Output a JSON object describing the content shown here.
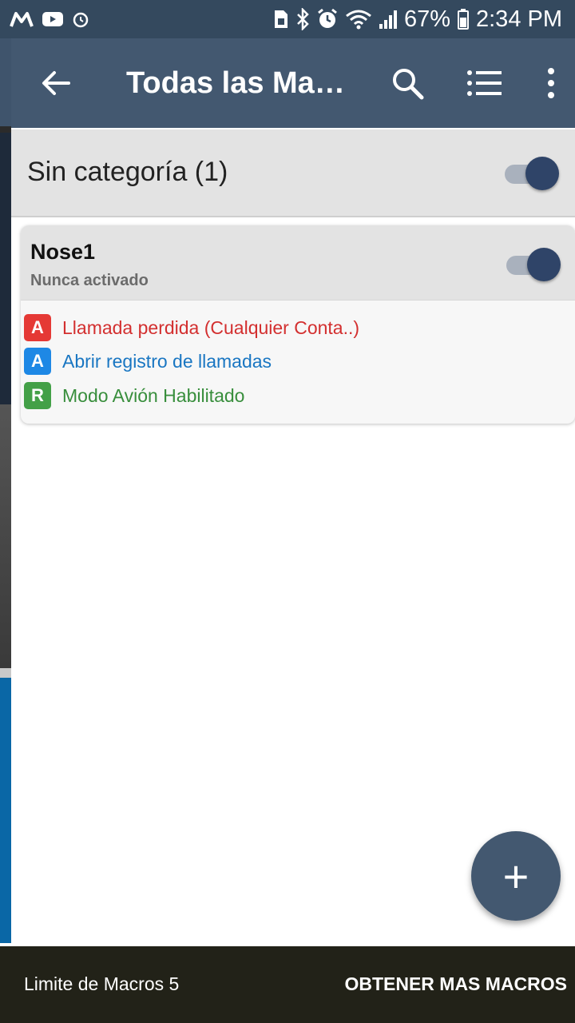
{
  "status_bar": {
    "left_icons": [
      "m-logo-icon",
      "youtube-icon",
      "alarm-icon"
    ],
    "right_icons": [
      "sim-icon",
      "bluetooth-icon",
      "alarm-clock-icon",
      "wifi-icon",
      "signal-icon"
    ],
    "battery": "67%",
    "time": "2:34 PM"
  },
  "app_bar": {
    "title": "Todas las Macros"
  },
  "category": {
    "label": "Sin categoría (1)",
    "enabled": true
  },
  "macro": {
    "name": "Nose1",
    "status": "Nunca activado",
    "enabled": true,
    "items": [
      {
        "badge": "A",
        "text": "Llamada perdida (Cualquier Conta..)",
        "badge_color": "#e53935",
        "text_color": "#d32f2f"
      },
      {
        "badge": "A",
        "text": "Abrir registro de llamadas",
        "badge_color": "#1e88e5",
        "text_color": "#1976c2"
      },
      {
        "badge": "R",
        "text": "Modo Avión Habilitado",
        "badge_color": "#43a047",
        "text_color": "#388e3c"
      }
    ]
  },
  "fab": {
    "label": "+"
  },
  "bottom_bar": {
    "limit_text": "Limite de Macros 5",
    "action_label": "OBTENER MAS MACROS"
  },
  "colors": {
    "status_bar": "#34495e",
    "app_bar": "#435870",
    "toggle_thumb": "#2f4468",
    "bottom_bar": "#222218"
  }
}
